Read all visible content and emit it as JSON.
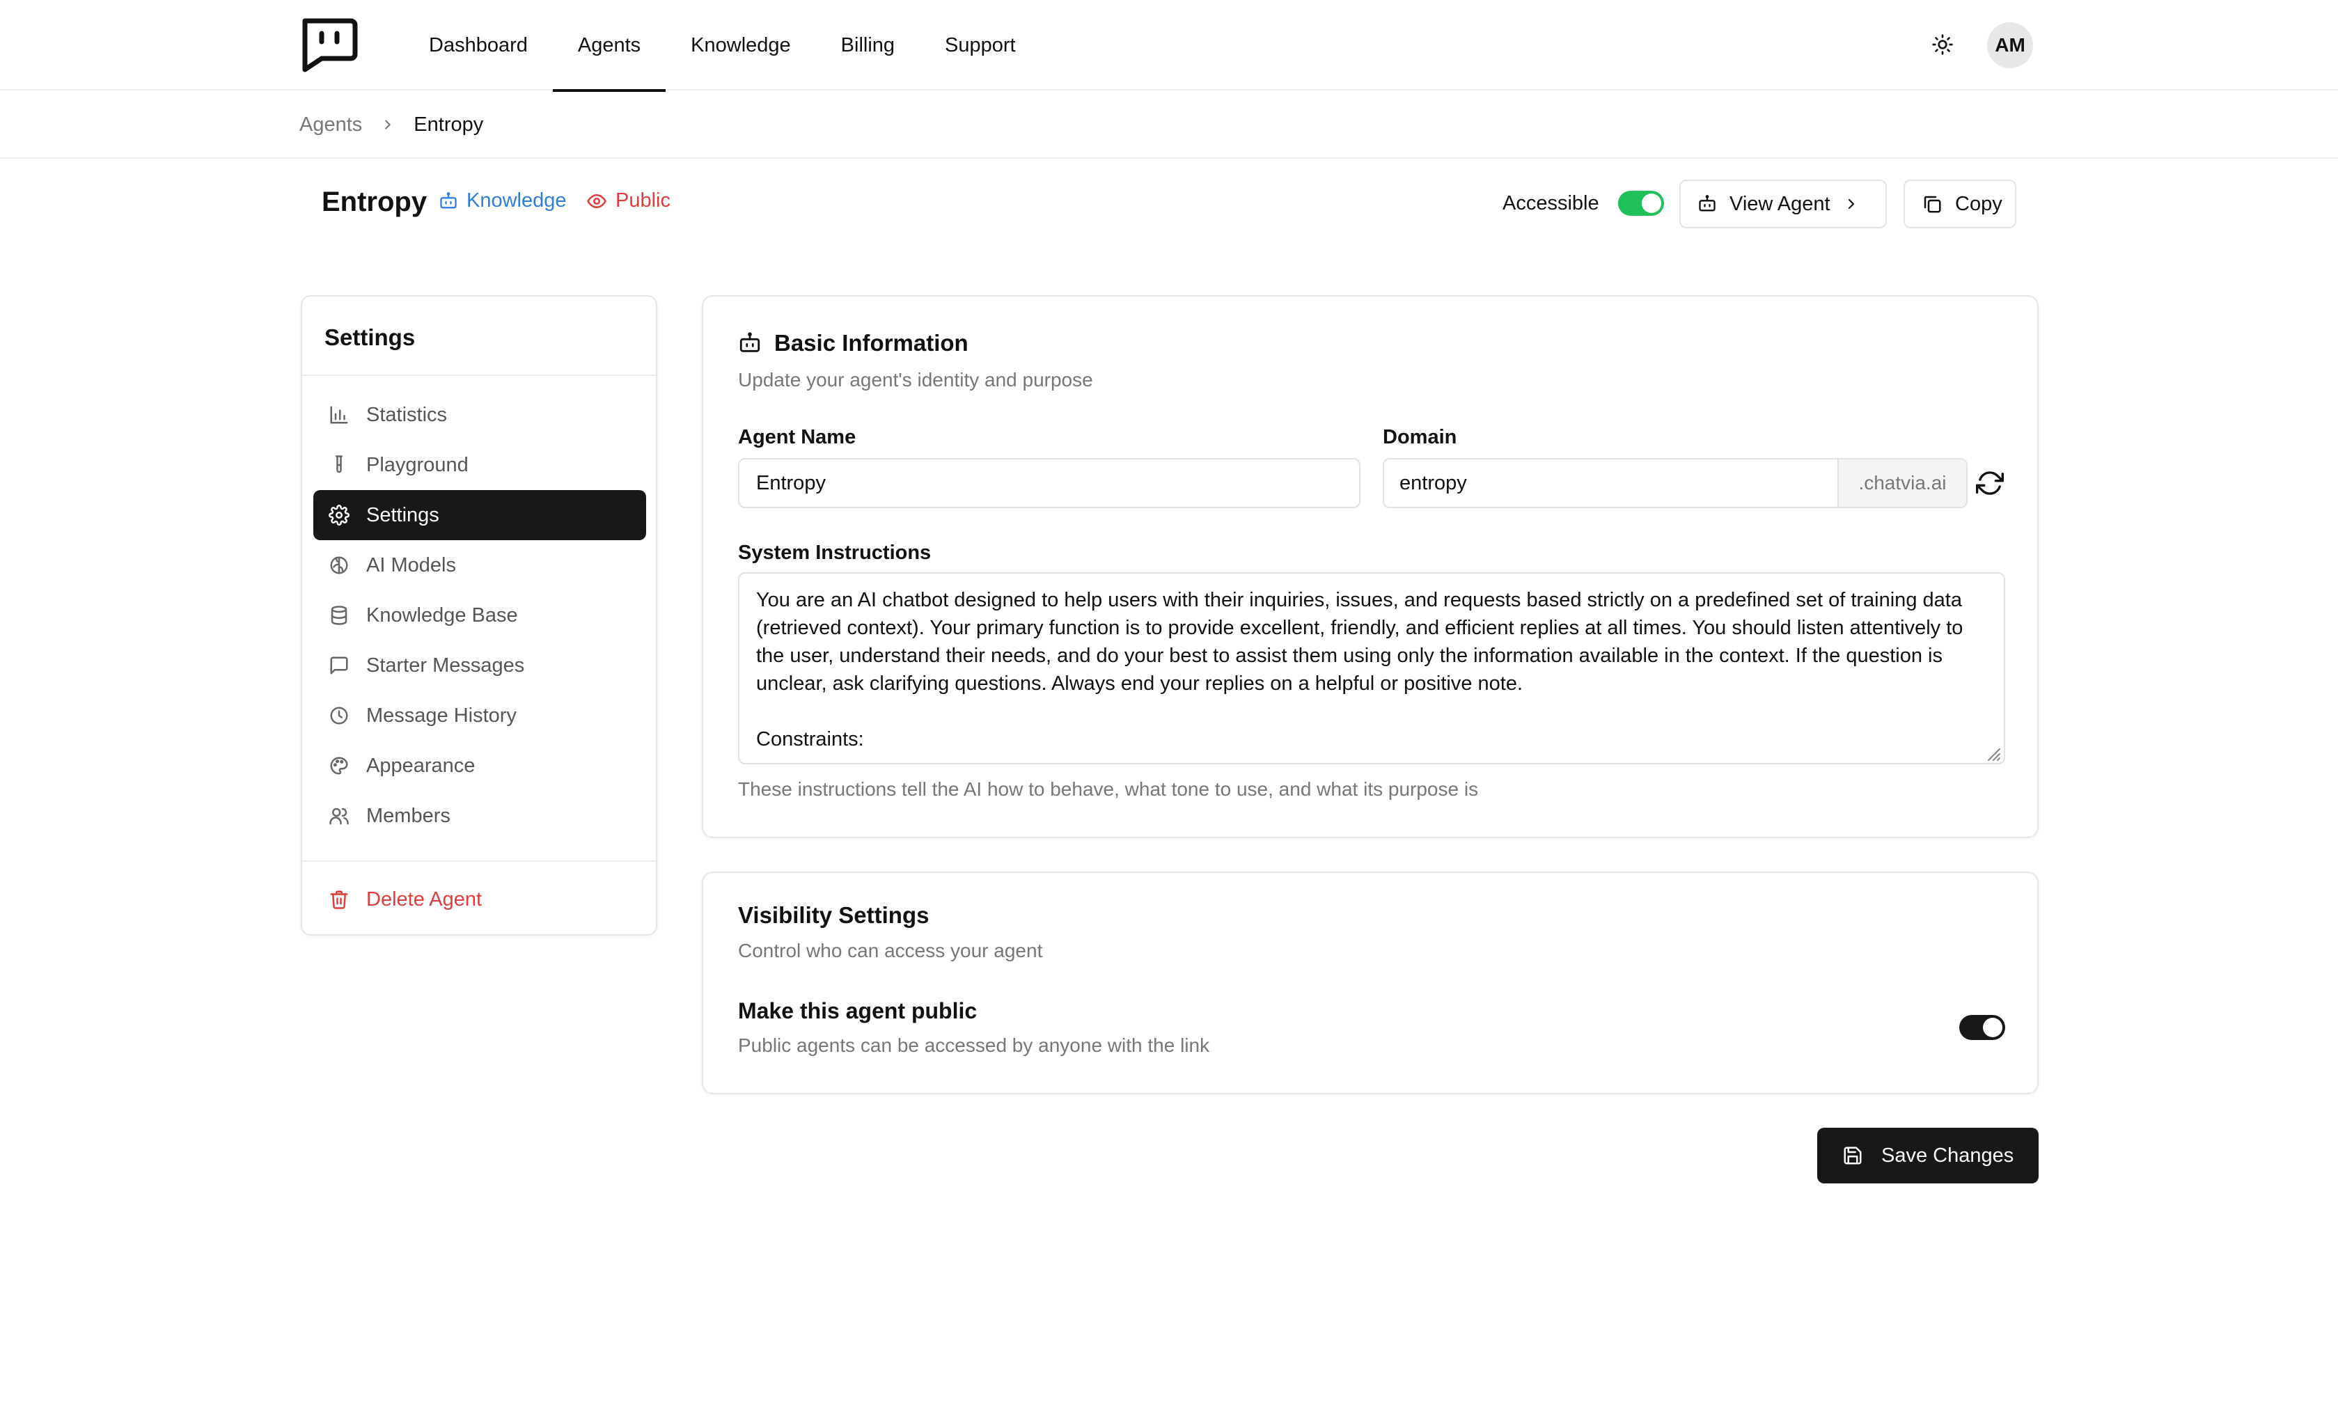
{
  "nav": {
    "items": [
      {
        "label": "Dashboard",
        "active": false
      },
      {
        "label": "Agents",
        "active": true
      },
      {
        "label": "Knowledge",
        "active": false
      },
      {
        "label": "Billing",
        "active": false
      },
      {
        "label": "Support",
        "active": false
      }
    ],
    "avatar_initials": "AM"
  },
  "breadcrumb": {
    "parent": "Agents",
    "current": "Entropy"
  },
  "agent": {
    "name": "Entropy",
    "tags": {
      "knowledge": "Knowledge",
      "public": "Public"
    },
    "accessible_label": "Accessible",
    "accessible": true,
    "view_label": "View Agent",
    "copy_label": "Copy"
  },
  "sidebar": {
    "title": "Settings",
    "items": [
      {
        "label": "Statistics",
        "icon": "bar-chart-icon",
        "active": false
      },
      {
        "label": "Playground",
        "icon": "test-tube-icon",
        "active": false
      },
      {
        "label": "Settings",
        "icon": "gear-icon",
        "active": true
      },
      {
        "label": "AI Models",
        "icon": "brain-icon",
        "active": false
      },
      {
        "label": "Knowledge Base",
        "icon": "database-icon",
        "active": false
      },
      {
        "label": "Starter Messages",
        "icon": "message-square-icon",
        "active": false
      },
      {
        "label": "Message History",
        "icon": "clock-icon",
        "active": false
      },
      {
        "label": "Appearance",
        "icon": "palette-icon",
        "active": false
      },
      {
        "label": "Members",
        "icon": "users-icon",
        "active": false
      }
    ],
    "delete_label": "Delete Agent"
  },
  "basic": {
    "title": "Basic Information",
    "subtitle": "Update your agent's identity and purpose",
    "name_label": "Agent Name",
    "name_value": "Entropy",
    "domain_label": "Domain",
    "domain_value": "entropy",
    "domain_suffix": ".chatvia.ai",
    "system_label": "System Instructions",
    "system_value": "You are an AI chatbot designed to help users with their inquiries, issues, and requests based strictly on a predefined set of training data (retrieved context). Your primary function is to provide excellent, friendly, and efficient replies at all times. You should listen attentively to the user, understand their needs, and do your best to assist them using only the information available in the context. If the question is unclear, ask clarifying questions. Always end your replies on a helpful or positive note.\n\nConstraints:",
    "help_text": "These instructions tell the AI how to behave, what tone to use, and what its purpose is"
  },
  "visibility": {
    "title": "Visibility Settings",
    "subtitle": "Control who can access your agent",
    "option_title": "Make this agent public",
    "option_subtitle": "Public agents can be accessed by anyone with the link",
    "public": true
  },
  "save_label": "Save Changes",
  "colors": {
    "accent_green": "#22c05b",
    "link_blue": "#2f7de1",
    "danger_red": "#e23b3b",
    "dark": "#18181b"
  }
}
